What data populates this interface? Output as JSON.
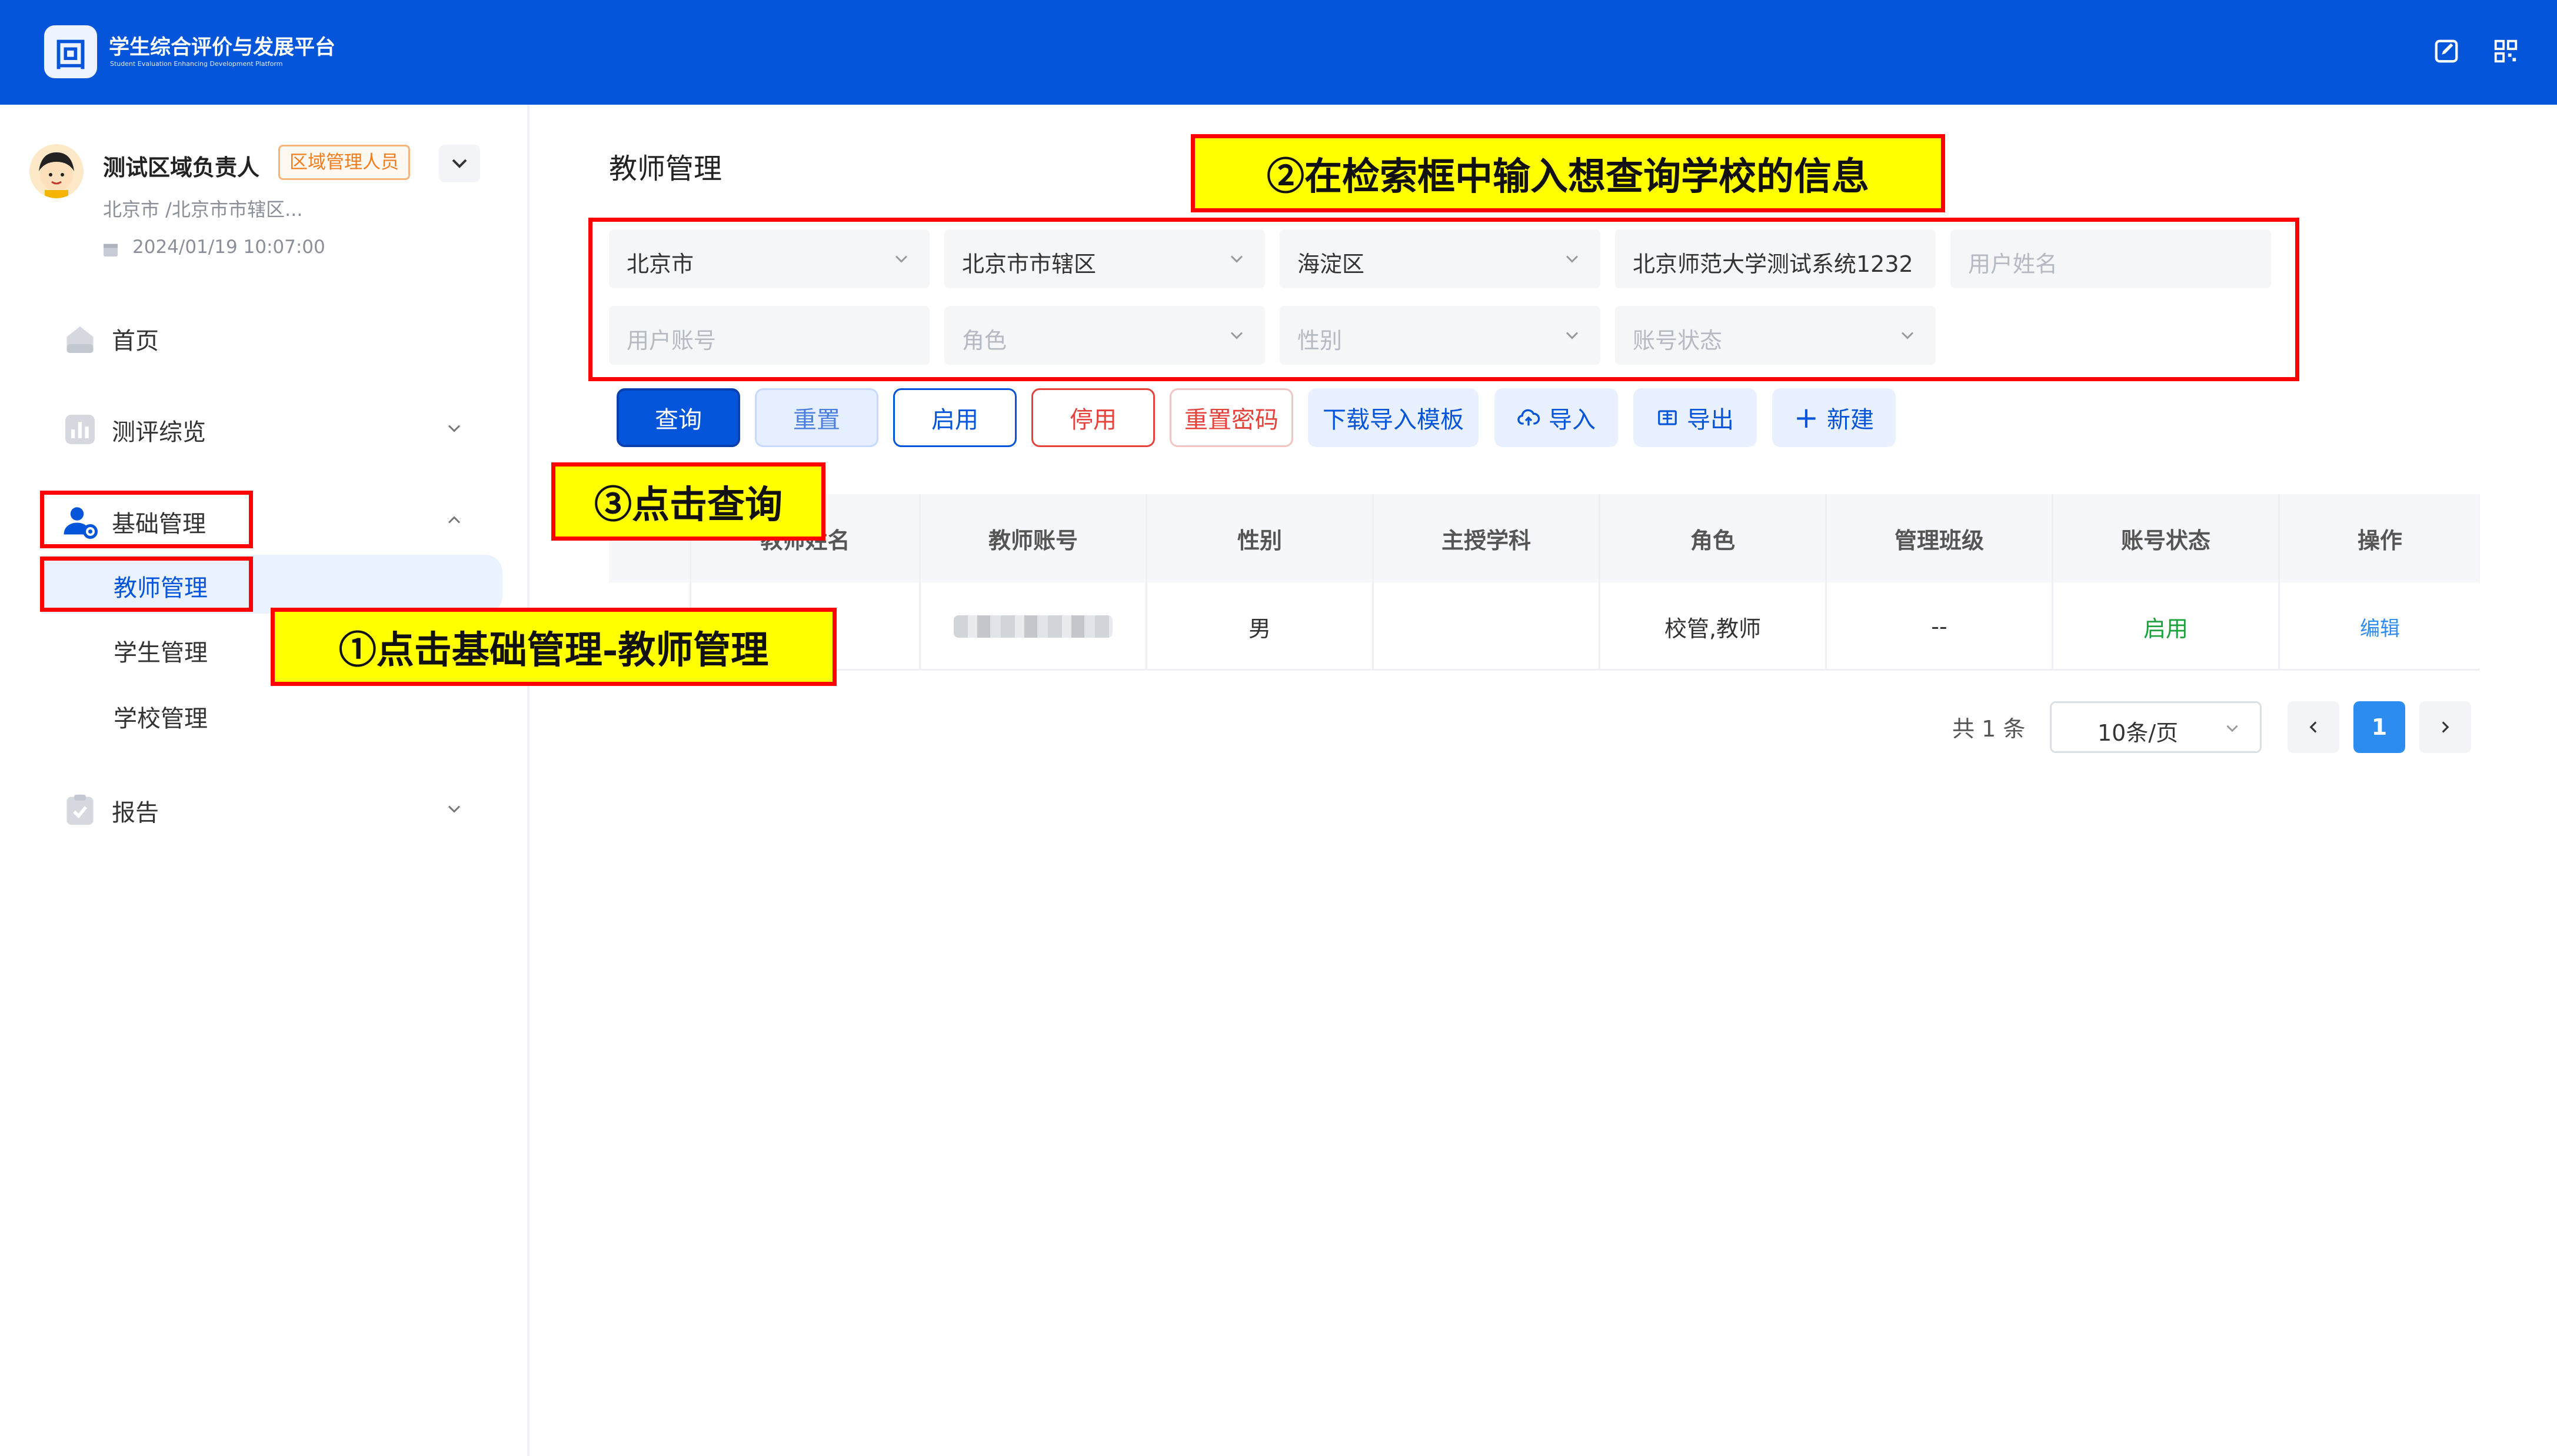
{
  "header": {
    "app_title": "学生综合评价与发展平台",
    "app_subtitle": "Student Evaluation Enhancing Development Platform",
    "logo_glyph": "回",
    "icons": [
      "edit-icon",
      "qrcode-icon"
    ]
  },
  "user": {
    "name": "测试区域负责人",
    "role_tag": "区域管理人员",
    "region": "北京市 /北京市市辖区...",
    "time": "2024/01/19 10:07:00"
  },
  "sidebar": {
    "items": [
      {
        "label": "首页",
        "icon": "home-icon"
      },
      {
        "label": "测评综览",
        "icon": "chart-icon",
        "chevron": "down"
      },
      {
        "label": "基础管理",
        "icon": "user-gear-icon",
        "chevron": "up",
        "children": [
          {
            "label": "教师管理",
            "active": true
          },
          {
            "label": "学生管理"
          },
          {
            "label": "学校管理"
          }
        ]
      },
      {
        "label": "报告",
        "icon": "clipboard-icon",
        "chevron": "down"
      }
    ]
  },
  "main": {
    "page_title": "教师管理",
    "filters": {
      "province": "北京市",
      "city": "北京市市辖区",
      "district": "海淀区",
      "school": "北京师范大学测试系统1232",
      "user_name_placeholder": "用户姓名",
      "account_placeholder": "用户账号",
      "role_placeholder": "角色",
      "gender_placeholder": "性别",
      "status_placeholder": "账号状态"
    },
    "buttons": {
      "query": "查询",
      "reset": "重置",
      "enable": "启用",
      "disable": "停用",
      "reset_password": "重置密码",
      "download_template": "下载导入模板",
      "import": "导入",
      "export": "导出",
      "create": "新建"
    },
    "table": {
      "columns": [
        "",
        "教师姓名",
        "教师账号",
        "性别",
        "主授学科",
        "角色",
        "管理班级",
        "账号状态",
        "操作"
      ],
      "rows": [
        {
          "name": "",
          "account": "",
          "gender": "男",
          "subject": "",
          "role": "校管,教师",
          "classes": "--",
          "status": "启用",
          "action": "编辑"
        }
      ]
    },
    "pagination": {
      "total": "共 1 条",
      "page_size": "10条/页",
      "current_page": "1"
    }
  },
  "annotations": {
    "step1": "①点击基础管理-教师管理",
    "step2": "②在检索框中输入想查询学校的信息",
    "step3": "③点击查询"
  },
  "colors": {
    "brand": "#0455d9",
    "annotation_border": "#ff0000",
    "annotation_fill": "#ffff00",
    "status_enabled": "#19a33a",
    "danger": "#e6423c",
    "role_tag": "#f07d1e"
  }
}
